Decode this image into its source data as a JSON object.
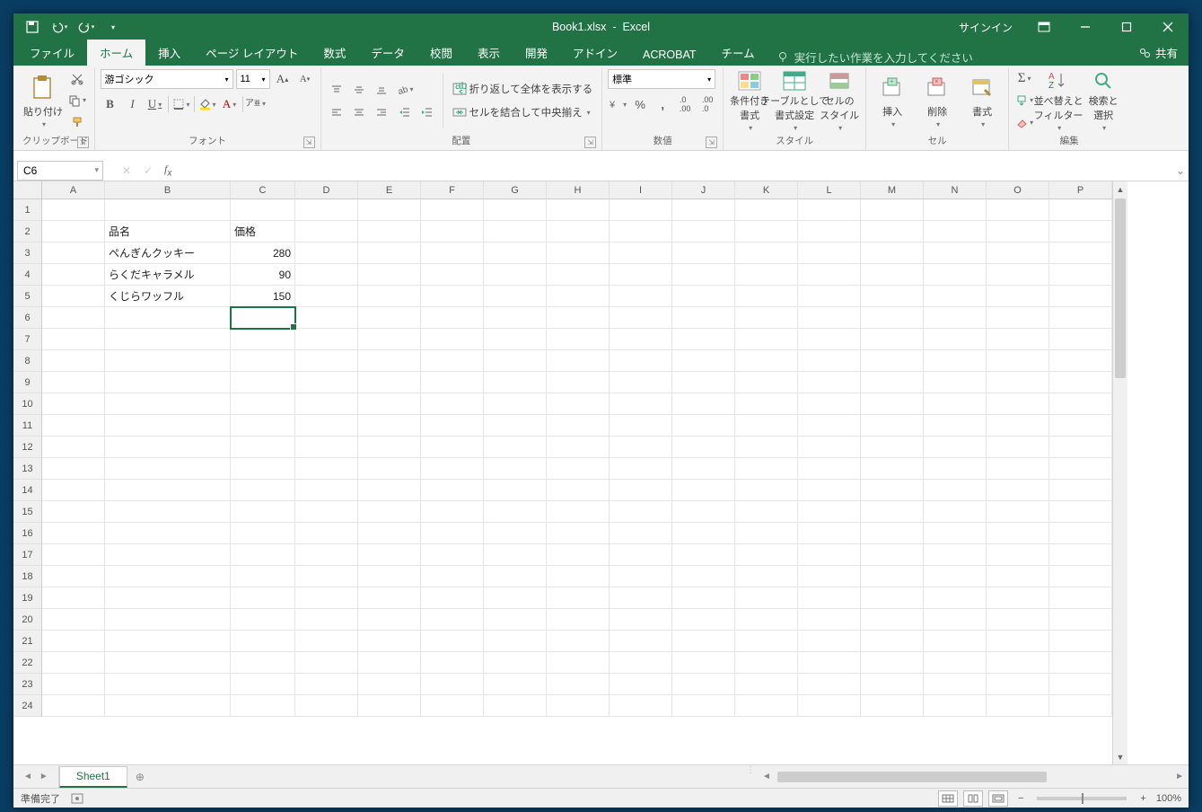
{
  "titlebar": {
    "document_title": "Book1.xlsx",
    "app_name": "Excel",
    "signin": "サインイン"
  },
  "tabs": {
    "file": "ファイル",
    "home": "ホーム",
    "insert": "挿入",
    "pagelayout": "ページ レイアウト",
    "formulas": "数式",
    "data": "データ",
    "review": "校閲",
    "view": "表示",
    "developer": "開発",
    "addins": "アドイン",
    "acrobat": "ACROBAT",
    "team": "チーム",
    "tellme": "実行したい作業を入力してください",
    "share": "共有"
  },
  "ribbon": {
    "clipboard": {
      "paste": "貼り付け",
      "label": "クリップボード"
    },
    "font": {
      "name": "游ゴシック",
      "size": "11",
      "label": "フォント",
      "ruby": "ア"
    },
    "alignment": {
      "wrap": "折り返して全体を表示する",
      "merge": "セルを結合して中央揃え",
      "label": "配置"
    },
    "number": {
      "format": "標準",
      "label": "数値"
    },
    "styles": {
      "cond": "条件付き\n書式",
      "table": "テーブルとして\n書式設定",
      "cell": "セルの\nスタイル",
      "label": "スタイル"
    },
    "cells": {
      "insert": "挿入",
      "delete": "削除",
      "format": "書式",
      "label": "セル"
    },
    "editing": {
      "sort": "並べ替えと\nフィルター",
      "find": "検索と\n選択",
      "label": "編集"
    }
  },
  "namebox": "C6",
  "columns": [
    "A",
    "B",
    "C",
    "D",
    "E",
    "F",
    "G",
    "H",
    "I",
    "J",
    "K",
    "L",
    "M",
    "N",
    "O",
    "P"
  ],
  "rows": 24,
  "cells": {
    "B2": "品名",
    "C2": "価格",
    "B3": "ぺんぎんクッキー",
    "C3": "280",
    "B4": "らくだキャラメル",
    "C4": "90",
    "B5": "くじらワッフル",
    "C5": "150"
  },
  "selected_cell": "C6",
  "sheets": {
    "sheet1": "Sheet1"
  },
  "statusbar": {
    "ready": "準備完了",
    "zoom": "100%"
  }
}
